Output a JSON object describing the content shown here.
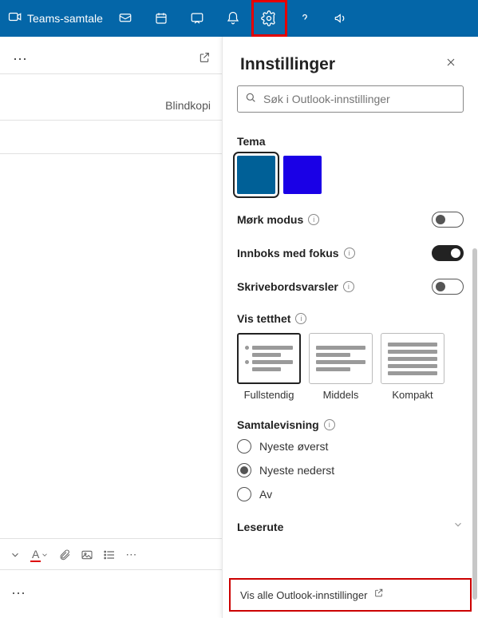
{
  "topbar": {
    "teams_label": "Teams-samtale"
  },
  "left": {
    "blindkopi": "Blindkopi"
  },
  "panel": {
    "title": "Innstillinger",
    "search_placeholder": "Søk i Outlook-innstillinger",
    "theme": {
      "label": "Tema",
      "colors": [
        "#006097",
        "#1a00e6"
      ]
    },
    "dark_mode": {
      "label": "Mørk modus",
      "on": false
    },
    "focused_inbox": {
      "label": "Innboks med fokus",
      "on": true
    },
    "desktop_notifications": {
      "label": "Skrivebordsvarsler",
      "on": false
    },
    "density": {
      "label": "Vis tetthet",
      "options": [
        {
          "label": "Fullstendig",
          "selected": true
        },
        {
          "label": "Middels",
          "selected": false
        },
        {
          "label": "Kompakt",
          "selected": false
        }
      ]
    },
    "conversation": {
      "label": "Samtalevisning",
      "options": [
        {
          "label": "Nyeste øverst",
          "selected": false
        },
        {
          "label": "Nyeste nederst",
          "selected": true
        },
        {
          "label": "Av",
          "selected": false
        }
      ]
    },
    "reading_pane": "Leserute",
    "footer_link": "Vis alle Outlook-innstillinger"
  }
}
